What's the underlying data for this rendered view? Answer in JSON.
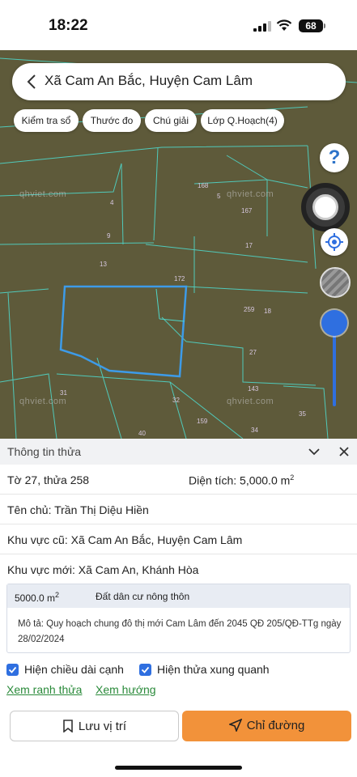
{
  "status_bar": {
    "time": "18:22",
    "battery": "68"
  },
  "search": {
    "title": "Xã Cam An Bắc, Huyện Cam Lâm"
  },
  "chips": [
    {
      "label": "Kiểm tra sổ"
    },
    {
      "label": "Thước đo"
    },
    {
      "label": "Chú giải"
    },
    {
      "label": "Lớp Q.Hoạch(4)"
    }
  ],
  "map": {
    "help_label": "?",
    "watermark": "qhviet.com",
    "parcel_labels": [
      "168",
      "5",
      "4",
      "167",
      "9",
      "17",
      "13",
      "172",
      "259",
      "18",
      "27",
      "31",
      "143",
      "32",
      "35",
      "159",
      "34",
      "40"
    ]
  },
  "panel": {
    "title": "Thông tin thửa",
    "sheet_parcel": "Tờ 27, thửa 258",
    "area_label": "Diện tích: 5,000.0 m",
    "area_sup": "2",
    "owner": "Tên chủ: Trần Thị Diệu Hiền",
    "old_area": "Khu vực cũ: Xã Cam An Bắc, Huyện Cam Lâm",
    "new_area": "Khu vực mới: Xã Cam An, Khánh Hòa",
    "zone_area": "5000.0 m",
    "zone_area_sup": "2",
    "zone_type": "Đất dân cư nông thôn",
    "zone_desc": "Mô tả: Quy hoạch chung đô thị mới Cam Lâm đến 2045 QĐ 205/QĐ-TTg ngày 28/02/2024",
    "show_edge_length": "Hiện chiều dài cạnh",
    "show_neighbors": "Hiện thửa xung quanh",
    "view_boundary": "Xem ranh thửa",
    "view_direction": "Xem hướng",
    "save_location": "Lưu vị trí",
    "directions": "Chỉ đường"
  },
  "colors": {
    "accent": "#2f6fe0",
    "route_button": "#f2923a",
    "map_bg": "#5e5a3a",
    "parcel_lines": "#4fd6c8"
  }
}
